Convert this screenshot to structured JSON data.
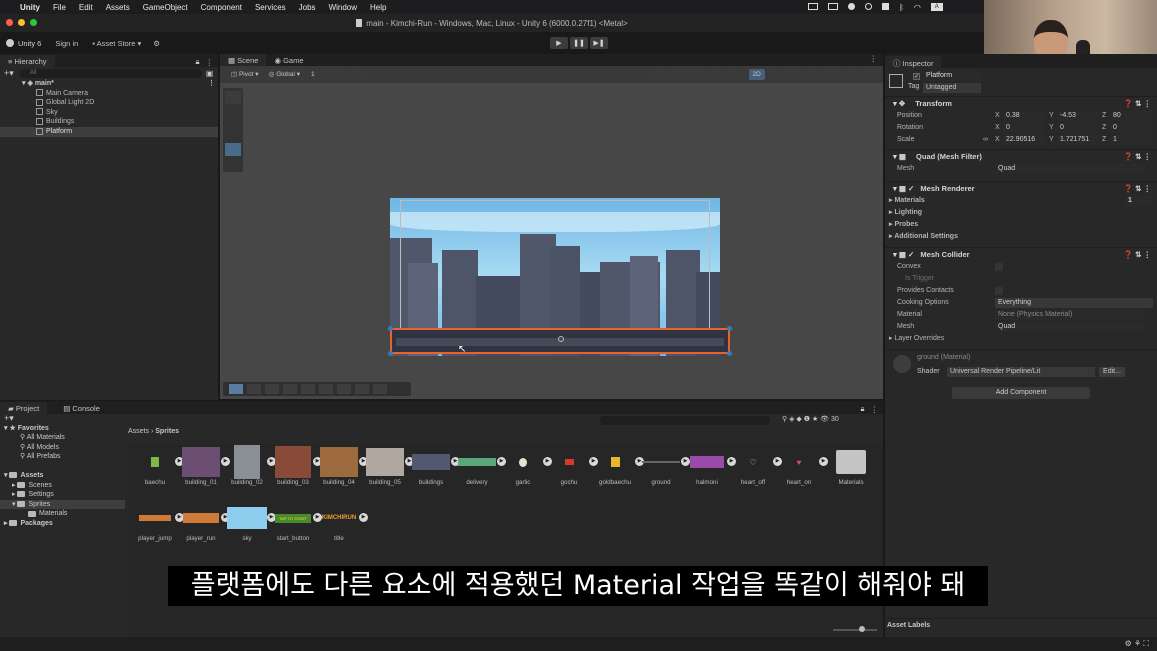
{
  "menubar": {
    "app": "Unity",
    "items": [
      "File",
      "Edit",
      "Assets",
      "GameObject",
      "Component",
      "Services",
      "Jobs",
      "Window",
      "Help"
    ]
  },
  "window": {
    "title": "main - Kimchi-Run - Windows, Mac, Linux - Unity 6 (6000.0.27f1) <Metal>"
  },
  "toolbar": {
    "account": "Unity 6",
    "signin": "Sign in",
    "asset_store": "Asset Store"
  },
  "hierarchy": {
    "tab": "Hierarchy",
    "search_placeholder": "All",
    "scene": "main*",
    "items": [
      "Main Camera",
      "Global Light 2D",
      "Sky",
      "Buildings",
      "Platform"
    ]
  },
  "scene_tabs": {
    "scene": "Scene",
    "game": "Game"
  },
  "scene_toolbar": {
    "pivot": "Pivot",
    "global": "Global",
    "grid": "1",
    "mode2d": "2D"
  },
  "inspector": {
    "tab": "Inspector",
    "object_name": "Platform",
    "tag_label": "Tag",
    "tag_value": "Untagged",
    "transform": {
      "title": "Transform",
      "position_label": "Position",
      "rotation_label": "Rotation",
      "scale_label": "Scale",
      "pos": {
        "x": "0.38",
        "y": "-4.53",
        "z": "80"
      },
      "rot": {
        "x": "0",
        "y": "0",
        "z": "0"
      },
      "scale": {
        "x": "22.90516",
        "y": "1.721751",
        "z": "1"
      }
    },
    "mesh_filter": {
      "title": "Quad (Mesh Filter)",
      "mesh_label": "Mesh",
      "mesh_value": "Quad"
    },
    "mesh_renderer": {
      "title": "Mesh Renderer",
      "materials": "Materials",
      "materials_count": "1",
      "lighting": "Lighting",
      "probes": "Probes",
      "additional": "Additional Settings"
    },
    "mesh_collider": {
      "title": "Mesh Collider",
      "convex": "Convex",
      "is_trigger": "Is Trigger",
      "provides_contacts": "Provides Contacts",
      "cooking_label": "Cooking Options",
      "cooking_value": "Everything",
      "material_label": "Material",
      "material_value": "None (Physics Material)",
      "mesh_label": "Mesh",
      "mesh_value": "Quad",
      "layer_overrides": "Layer Overrides"
    },
    "material": {
      "name": "ground (Material)",
      "shader_label": "Shader",
      "shader_value": "Universal Render Pipeline/Lit",
      "edit": "Edit..."
    },
    "add_component": "Add Component",
    "asset_labels": "Asset Labels"
  },
  "project": {
    "tab": "Project",
    "console_tab": "Console",
    "favorites": "Favorites",
    "fav_items": [
      "All Materials",
      "All Models",
      "All Prefabs"
    ],
    "assets": "Assets",
    "asset_folders": [
      "Scenes",
      "Settings",
      "Sprites"
    ],
    "sprites_sub": "Materials",
    "packages": "Packages",
    "breadcrumb_root": "Assets",
    "breadcrumb_current": "Sprites",
    "count": "30",
    "asset_names": [
      "baechu",
      "building_01",
      "building_02",
      "building_03",
      "building_04",
      "building_05",
      "buildings",
      "delivery",
      "garlic",
      "gochu",
      "goldbaechu",
      "ground",
      "halmoni",
      "heart_off",
      "heart_on",
      "Materials",
      "player_jump",
      "player_run",
      "sky",
      "start_button",
      "title"
    ],
    "title_sprite_text": "KIMCHIRUN",
    "start_sprite_text": "TAP TO START"
  },
  "subtitle": "플랫폼에도 다른 요소에 적용했던 Material 작업을 똑같이 해줘야 돼",
  "colors": {
    "accent": "#3a79bb",
    "selection": "#2c5d87",
    "platform_outline": "#e8622a",
    "sky": "#7ec3ea"
  }
}
